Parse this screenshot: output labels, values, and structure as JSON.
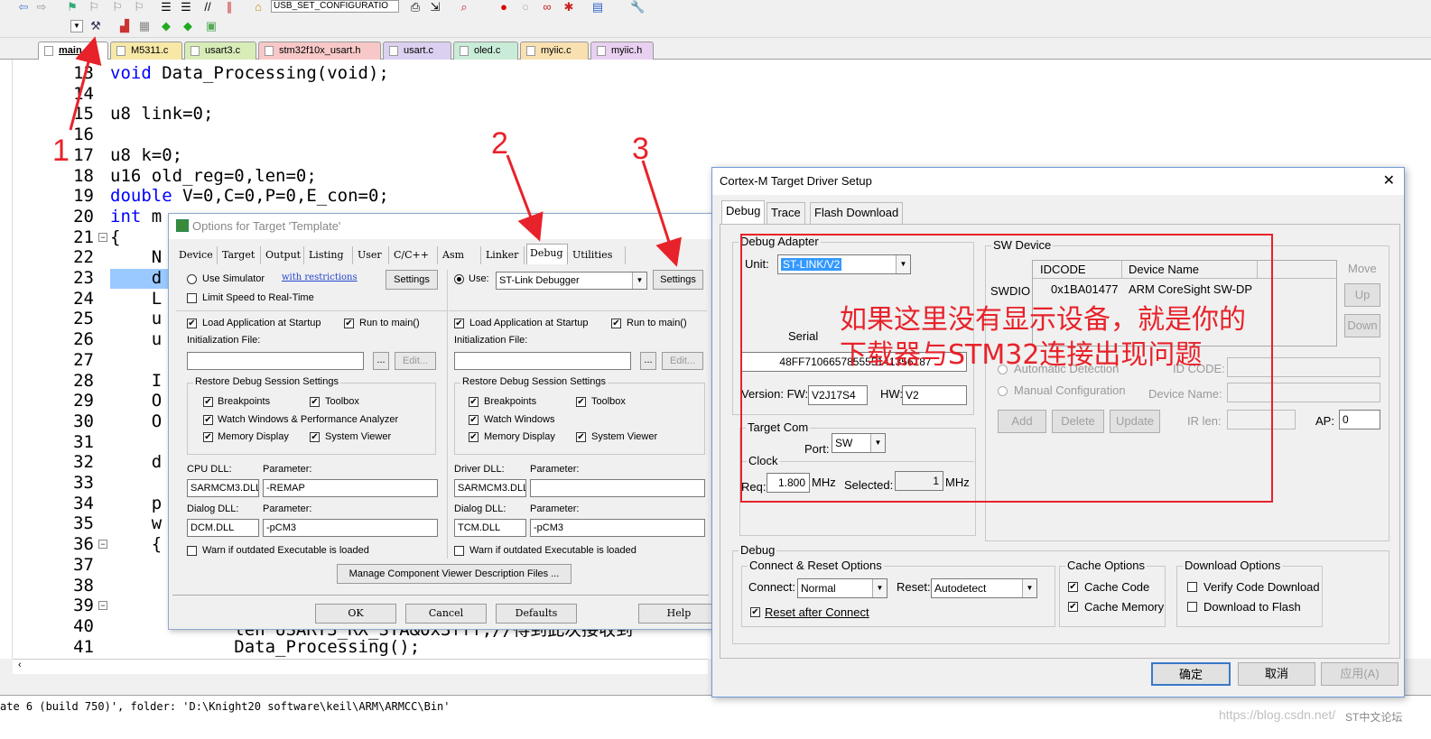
{
  "toolbar": {
    "target_combo": "USB_SET_CONFIGURATIO"
  },
  "file_tabs": [
    {
      "label": "main.c",
      "color": "#ffffff"
    },
    {
      "label": "M5311.c",
      "color": "#f7e8a8"
    },
    {
      "label": "usart3.c",
      "color": "#d8ecb8"
    },
    {
      "label": "stm32f10x_usart.h",
      "color": "#f8c8c8"
    },
    {
      "label": "usart.c",
      "color": "#dcd0f0"
    },
    {
      "label": "oled.c",
      "color": "#c8ecd8"
    },
    {
      "label": "myiic.c",
      "color": "#f8e0b0"
    },
    {
      "label": "myiic.h",
      "color": "#e8d0f0"
    }
  ],
  "editor": {
    "line_numbers": [
      "13",
      "14",
      "15",
      "16",
      "17",
      "18",
      "19",
      "20",
      "21",
      "22",
      "23",
      "24",
      "25",
      "26",
      "27",
      "28",
      "29",
      "30",
      "31",
      "32",
      "33",
      "34",
      "35",
      "36",
      "37",
      "38",
      "39",
      "40",
      "41"
    ],
    "lines": [
      {
        "kw": "void",
        "rest": " Data_Processing(void);"
      },
      {
        "kw": "",
        "rest": ""
      },
      {
        "kw": "",
        "rest": "u8 link=0;"
      },
      {
        "kw": "",
        "rest": ""
      },
      {
        "kw": "",
        "rest": "u8 k=0;"
      },
      {
        "kw": "",
        "rest": "u16 old_reg=0,len=0;"
      },
      {
        "kw": "double",
        "rest": " V=0,C=0,P=0,E_con=0;"
      },
      {
        "kw": "int",
        "rest": " m"
      },
      {
        "kw": "",
        "rest": "{"
      },
      {
        "kw": "",
        "rest": "    N"
      },
      {
        "kw": "",
        "rest": "    d"
      },
      {
        "kw": "",
        "rest": "    L"
      },
      {
        "kw": "",
        "rest": "    u"
      },
      {
        "kw": "",
        "rest": "    u"
      },
      {
        "kw": "",
        "rest": ""
      },
      {
        "kw": "",
        "rest": "    I"
      },
      {
        "kw": "",
        "rest": "    O"
      },
      {
        "kw": "",
        "rest": "    O"
      },
      {
        "kw": "",
        "rest": ""
      },
      {
        "kw": "",
        "rest": "    d"
      },
      {
        "kw": "",
        "rest": ""
      },
      {
        "kw": "",
        "rest": "    p"
      },
      {
        "kw": "",
        "rest": "    w"
      },
      {
        "kw": "",
        "rest": "    {"
      },
      {
        "kw": "",
        "rest": ""
      },
      {
        "kw": "",
        "rest": ""
      },
      {
        "kw": "",
        "rest": ""
      },
      {
        "kw": "",
        "rest": "            len USART3_RX_STA&0x3fff;//得到此次接收到"
      },
      {
        "kw": "",
        "rest": "            Data_Processing();"
      }
    ]
  },
  "output": {
    "text": "ate 6 (build 750)', folder: 'D:\\Knight20 software\\keil\\ARM\\ARMCC\\Bin'"
  },
  "options_dialog": {
    "title": "Options for Target 'Template'",
    "tabs": [
      "Device",
      "Target",
      "Output",
      "Listing",
      "User",
      "C/C++",
      "Asm",
      "Linker",
      "Debug",
      "Utilities"
    ],
    "active_tab": "Debug",
    "left": {
      "use_simulator": "Use Simulator",
      "with_restrictions": "with restrictions",
      "settings": "Settings",
      "limit_speed": "Limit Speed to Real-Time",
      "load_app": "Load Application at Startup",
      "run_to_main": "Run to main()",
      "init_file": "Initialization File:",
      "edit": "Edit...",
      "browse": "...",
      "restore_group": "Restore Debug Session Settings",
      "breakpoints": "Breakpoints",
      "toolbox": "Toolbox",
      "watch_windows": "Watch Windows & Performance Analyzer",
      "memory_display": "Memory Display",
      "system_viewer": "System Viewer",
      "cpu_dll_label": "CPU DLL:",
      "parameter_label": "Parameter:",
      "cpu_dll": "SARMCM3.DLL",
      "cpu_param": "-REMAP",
      "dialog_dll_label": "Dialog DLL:",
      "dialog_dll": "DCM.DLL",
      "dialog_param": "-pCM3",
      "warn": "Warn if outdated Executable is loaded"
    },
    "right": {
      "use": "Use:",
      "debugger": "ST-Link Debugger",
      "settings": "Settings",
      "load_app": "Load Application at Startup",
      "run_to_main": "Run to main()",
      "init_file": "Initialization File:",
      "edit": "Edit...",
      "browse": "...",
      "restore_group": "Restore Debug Session Settings",
      "breakpoints": "Breakpoints",
      "toolbox": "Toolbox",
      "watch_windows": "Watch Windows",
      "memory_display": "Memory Display",
      "system_viewer": "System Viewer",
      "driver_dll_label": "Driver DLL:",
      "parameter_label": "Parameter:",
      "driver_dll": "SARMCM3.DLL",
      "driver_param": "",
      "dialog_dll_label": "Dialog DLL:",
      "dialog_dll": "TCM.DLL",
      "dialog_param": "-pCM3",
      "warn": "Warn if outdated Executable is loaded"
    },
    "manage_button": "Manage Component Viewer Description Files ...",
    "ok": "OK",
    "cancel": "Cancel",
    "defaults": "Defaults",
    "help": "Help"
  },
  "cortex_dialog": {
    "title": "Cortex-M Target Driver Setup",
    "close": "✕",
    "tabs": [
      "Debug",
      "Trace",
      "Flash Download"
    ],
    "active_tab": "Debug",
    "debug_adapter_group": "Debug Adapter",
    "unit_label": "Unit:",
    "unit_value": "ST-LINK/V2",
    "serial_label": "Serial",
    "serial_value": "48FF710665785555141356187",
    "version_label": "Version: FW:",
    "fw_value": "V2J17S4",
    "hw_label": "HW:",
    "hw_value": "V2",
    "target_com_group": "Target Com",
    "port_label": "Port:",
    "port_value": "SW",
    "clock_group": "Clock",
    "req_label": "Req:",
    "req_value": "1.800",
    "mhz": "MHz",
    "selected_label": "Selected:",
    "selected_value": "1",
    "sw_device_group": "SW Device",
    "swdio": "SWDIO",
    "col_idcode": "IDCODE",
    "col_device": "Device Name",
    "idcode": "0x1BA01477",
    "device_name": "ARM CoreSight SW-DP",
    "move": "Move",
    "up": "Up",
    "down": "Down",
    "auto_detect": "Automatic Detection",
    "manual_config": "Manual Configuration",
    "id_code_label": "ID CODE:",
    "device_name_label": "Device Name:",
    "add": "Add",
    "delete": "Delete",
    "update": "Update",
    "ir_len": "IR len:",
    "ap_label": "AP:",
    "ap_value": "0",
    "debug_group": "Debug",
    "connect_reset_group": "Connect & Reset Options",
    "connect_label": "Connect:",
    "connect_value": "Normal",
    "reset_label": "Reset:",
    "reset_value": "Autodetect",
    "reset_after_connect": "Reset after Connect",
    "cache_group": "Cache Options",
    "cache_code": "Cache Code",
    "cache_memory": "Cache Memory",
    "download_group": "Download Options",
    "verify_code": "Verify Code Download",
    "download_flash": "Download to Flash",
    "ok": "确定",
    "cancel": "取消",
    "apply": "应用(A)"
  },
  "annotations": {
    "note_line1": "如果这里没有显示设备，就是你的",
    "note_line2": "下载器与STM32连接出现问题",
    "step1": "1",
    "step2": "2",
    "step3": "3",
    "watermark1": "https://blog.csdn.net/",
    "watermark2": "ST中文论坛"
  },
  "colors": {
    "annotation_red": "#e8222a",
    "keyword_blue": "#0000ff",
    "selection_blue": "#3399ff"
  }
}
